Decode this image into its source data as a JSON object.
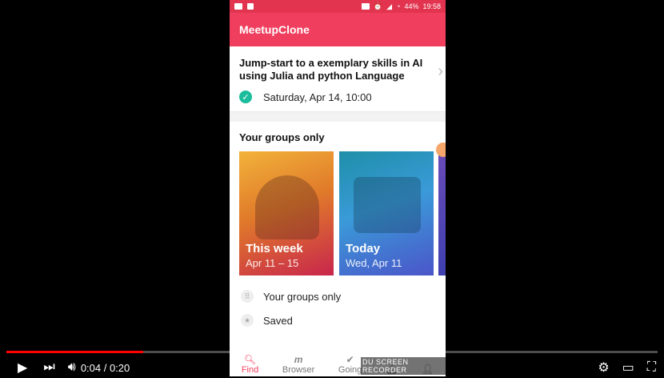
{
  "statusbar": {
    "battery": "44%",
    "time": "19:58"
  },
  "app": {
    "title": "MeetupClone"
  },
  "event": {
    "title": "Jump-start to a exemplary skills in AI using Julia and python Language",
    "date": "Saturday, Apr 14, 10:00"
  },
  "groups": {
    "title": "Your groups only",
    "tiles": [
      {
        "name": "This week",
        "dates": "Apr 11 – 15"
      },
      {
        "name": "Today",
        "dates": "Wed, Apr 11"
      }
    ]
  },
  "list": [
    {
      "label": "Your groups only"
    },
    {
      "label": "Saved"
    }
  ],
  "nav": [
    {
      "label": "Find"
    },
    {
      "label": "Browser"
    },
    {
      "label": "Going"
    },
    {
      "label": ""
    },
    {
      "label": ""
    }
  ],
  "watermark": "DU SCREEN RECORDER",
  "player": {
    "time": "0:04 / 0:20",
    "progress": 0.21
  },
  "colors": {
    "accent": "#f03f5e",
    "check": "#1abc9c"
  }
}
